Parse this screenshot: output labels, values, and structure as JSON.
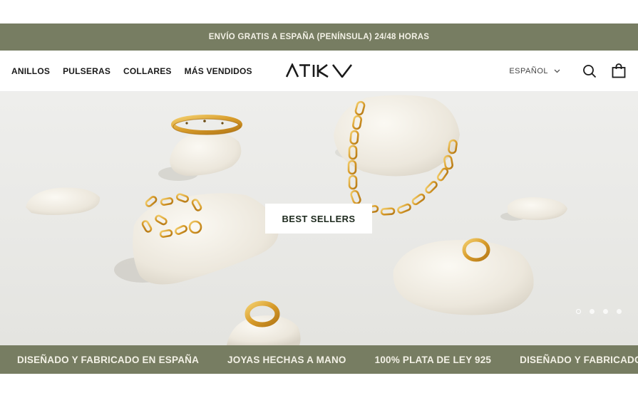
{
  "announcement": {
    "text": "ENVÍO GRATIS A ESPAÑA (PENÍNSULA) 24/48 HORAS"
  },
  "header": {
    "nav": [
      {
        "label": "ANILLOS"
      },
      {
        "label": "PULSERAS"
      },
      {
        "label": "COLLARES"
      },
      {
        "label": "MÁS VENDIDOS"
      }
    ],
    "logo_text": "ATIKA",
    "language": {
      "label": "ESPAÑOL",
      "icon": "chevron-down-icon"
    },
    "icons": [
      "search-icon",
      "shopping-bag-icon"
    ]
  },
  "hero": {
    "cta_label": "BEST SELLERS",
    "slides_count": 4,
    "active_slide": 1
  },
  "marquee": {
    "items": [
      "DISEÑADO Y FABRICADO EN ESPAÑA",
      "JOYAS HECHAS A MANO",
      "100% PLATA DE LEY 925",
      "DISEÑADO Y FABRICADO EN ESPAÑA"
    ]
  },
  "colors": {
    "brand_green": "#777d62",
    "bar_text": "#f3f1e6",
    "gold": "#d9a53a",
    "stone": "#f1ede4"
  }
}
